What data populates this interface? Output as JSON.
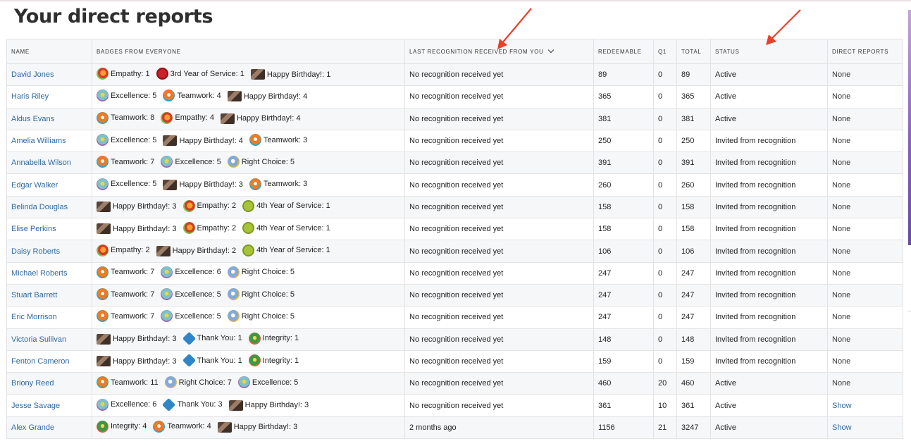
{
  "page": {
    "title": "Your direct reports"
  },
  "table": {
    "headers": {
      "name": "NAME",
      "badges": "BADGES FROM EVERYONE",
      "last_recognition": "LAST RECOGNITION RECEIVED FROM YOU",
      "redeemable": "REDEEMABLE",
      "q1": "Q1",
      "total": "TOTAL",
      "status": "STATUS",
      "direct_reports": "DIRECT REPORTS"
    },
    "rows": [
      {
        "name": "David Jones",
        "badges": [
          {
            "icon": "empathy",
            "label": "Empathy: 1"
          },
          {
            "icon": "3rd-year",
            "label": "3rd Year of Service: 1"
          },
          {
            "icon": "birthday",
            "label": "Happy Birthday!: 1"
          }
        ],
        "last": "No recognition received yet",
        "redeemable": "89",
        "q1": "0",
        "total": "89",
        "status": "Active",
        "dr": "None"
      },
      {
        "name": "Haris Riley",
        "badges": [
          {
            "icon": "excellence",
            "label": "Excellence: 5"
          },
          {
            "icon": "teamwork",
            "label": "Teamwork: 4"
          },
          {
            "icon": "birthday",
            "label": "Happy Birthday!: 4"
          }
        ],
        "last": "No recognition received yet",
        "redeemable": "365",
        "q1": "0",
        "total": "365",
        "status": "Active",
        "dr": "None"
      },
      {
        "name": "Aldus Evans",
        "badges": [
          {
            "icon": "teamwork",
            "label": "Teamwork: 8"
          },
          {
            "icon": "empathy",
            "label": "Empathy: 4"
          },
          {
            "icon": "birthday",
            "label": "Happy Birthday!: 4"
          }
        ],
        "last": "No recognition received yet",
        "redeemable": "381",
        "q1": "0",
        "total": "381",
        "status": "Active",
        "dr": "None"
      },
      {
        "name": "Amelia Williams",
        "badges": [
          {
            "icon": "excellence",
            "label": "Excellence: 5"
          },
          {
            "icon": "birthday",
            "label": "Happy Birthday!: 4"
          },
          {
            "icon": "teamwork",
            "label": "Teamwork: 3"
          }
        ],
        "last": "No recognition received yet",
        "redeemable": "250",
        "q1": "0",
        "total": "250",
        "status": "Invited from recognition",
        "dr": "None"
      },
      {
        "name": "Annabella Wilson",
        "badges": [
          {
            "icon": "teamwork",
            "label": "Teamwork: 7"
          },
          {
            "icon": "excellence",
            "label": "Excellence: 5"
          },
          {
            "icon": "right-choice",
            "label": "Right Choice: 5"
          }
        ],
        "last": "No recognition received yet",
        "redeemable": "391",
        "q1": "0",
        "total": "391",
        "status": "Invited from recognition",
        "dr": "None"
      },
      {
        "name": "Edgar Walker",
        "badges": [
          {
            "icon": "excellence",
            "label": "Excellence: 5"
          },
          {
            "icon": "birthday",
            "label": "Happy Birthday!: 3"
          },
          {
            "icon": "teamwork",
            "label": "Teamwork: 3"
          }
        ],
        "last": "No recognition received yet",
        "redeemable": "260",
        "q1": "0",
        "total": "260",
        "status": "Invited from recognition",
        "dr": "None"
      },
      {
        "name": "Belinda Douglas",
        "badges": [
          {
            "icon": "birthday",
            "label": "Happy Birthday!: 3"
          },
          {
            "icon": "empathy",
            "label": "Empathy: 2"
          },
          {
            "icon": "4th-year",
            "label": "4th Year of Service: 1"
          }
        ],
        "last": "No recognition received yet",
        "redeemable": "158",
        "q1": "0",
        "total": "158",
        "status": "Invited from recognition",
        "dr": "None"
      },
      {
        "name": "Elise Perkins",
        "badges": [
          {
            "icon": "birthday",
            "label": "Happy Birthday!: 3"
          },
          {
            "icon": "empathy",
            "label": "Empathy: 2"
          },
          {
            "icon": "4th-year",
            "label": "4th Year of Service: 1"
          }
        ],
        "last": "No recognition received yet",
        "redeemable": "158",
        "q1": "0",
        "total": "158",
        "status": "Invited from recognition",
        "dr": "None"
      },
      {
        "name": "Daisy Roberts",
        "badges": [
          {
            "icon": "empathy",
            "label": "Empathy: 2"
          },
          {
            "icon": "birthday",
            "label": "Happy Birthday!: 2"
          },
          {
            "icon": "4th-year",
            "label": "4th Year of Service: 1"
          }
        ],
        "last": "No recognition received yet",
        "redeemable": "106",
        "q1": "0",
        "total": "106",
        "status": "Invited from recognition",
        "dr": "None"
      },
      {
        "name": "Michael Roberts",
        "badges": [
          {
            "icon": "teamwork",
            "label": "Teamwork: 7"
          },
          {
            "icon": "excellence",
            "label": "Excellence: 6"
          },
          {
            "icon": "right-choice",
            "label": "Right Choice: 5"
          }
        ],
        "last": "No recognition received yet",
        "redeemable": "247",
        "q1": "0",
        "total": "247",
        "status": "Invited from recognition",
        "dr": "None"
      },
      {
        "name": "Stuart Barrett",
        "badges": [
          {
            "icon": "teamwork",
            "label": "Teamwork: 7"
          },
          {
            "icon": "excellence",
            "label": "Excellence: 5"
          },
          {
            "icon": "right-choice",
            "label": "Right Choice: 5"
          }
        ],
        "last": "No recognition received yet",
        "redeemable": "247",
        "q1": "0",
        "total": "247",
        "status": "Invited from recognition",
        "dr": "None"
      },
      {
        "name": "Eric Morrison",
        "badges": [
          {
            "icon": "teamwork",
            "label": "Teamwork: 7"
          },
          {
            "icon": "excellence",
            "label": "Excellence: 5"
          },
          {
            "icon": "right-choice",
            "label": "Right Choice: 5"
          }
        ],
        "last": "No recognition received yet",
        "redeemable": "247",
        "q1": "0",
        "total": "247",
        "status": "Invited from recognition",
        "dr": "None"
      },
      {
        "name": "Victoria Sullivan",
        "badges": [
          {
            "icon": "birthday",
            "label": "Happy Birthday!: 3"
          },
          {
            "icon": "thank-you",
            "label": "Thank You: 1"
          },
          {
            "icon": "integrity",
            "label": "Integrity: 1"
          }
        ],
        "last": "No recognition received yet",
        "redeemable": "148",
        "q1": "0",
        "total": "148",
        "status": "Invited from recognition",
        "dr": "None"
      },
      {
        "name": "Fenton Cameron",
        "badges": [
          {
            "icon": "birthday",
            "label": "Happy Birthday!: 3"
          },
          {
            "icon": "thank-you",
            "label": "Thank You: 1"
          },
          {
            "icon": "integrity",
            "label": "Integrity: 1"
          }
        ],
        "last": "No recognition received yet",
        "redeemable": "159",
        "q1": "0",
        "total": "159",
        "status": "Invited from recognition",
        "dr": "None"
      },
      {
        "name": "Briony Reed",
        "badges": [
          {
            "icon": "teamwork",
            "label": "Teamwork: 11"
          },
          {
            "icon": "right-choice",
            "label": "Right Choice: 7"
          },
          {
            "icon": "excellence",
            "label": "Excellence: 5"
          }
        ],
        "last": "No recognition received yet",
        "redeemable": "460",
        "q1": "20",
        "total": "460",
        "status": "Active",
        "dr": "None"
      },
      {
        "name": "Jesse Savage",
        "badges": [
          {
            "icon": "excellence",
            "label": "Excellence: 6"
          },
          {
            "icon": "thank-you",
            "label": "Thank You: 3"
          },
          {
            "icon": "birthday",
            "label": "Happy Birthday!: 3"
          }
        ],
        "last": "No recognition received yet",
        "redeemable": "361",
        "q1": "10",
        "total": "361",
        "status": "Active",
        "dr": "Show"
      },
      {
        "name": "Alex Grande",
        "badges": [
          {
            "icon": "integrity",
            "label": "Integrity: 4"
          },
          {
            "icon": "teamwork",
            "label": "Teamwork: 4"
          },
          {
            "icon": "birthday",
            "label": "Happy Birthday!: 3"
          }
        ],
        "last": "2 months ago",
        "redeemable": "1156",
        "q1": "21",
        "total": "3247",
        "status": "Active",
        "dr": "Show"
      }
    ]
  },
  "colors": {
    "link": "#2f6aa3",
    "arrow": "#e8412c",
    "stripe": "#f6f7f9",
    "accent": "#8e5fc0"
  }
}
